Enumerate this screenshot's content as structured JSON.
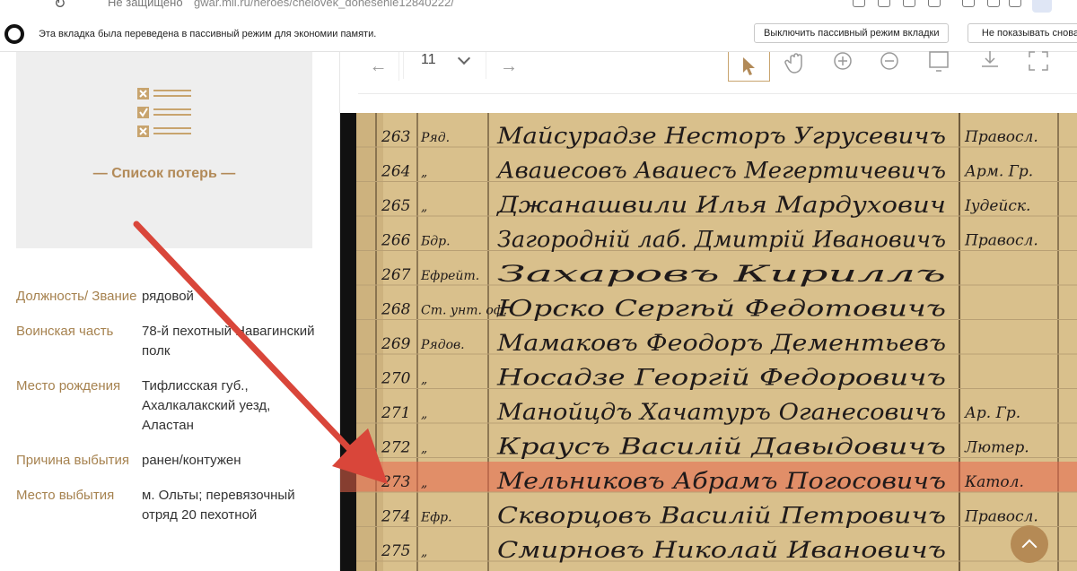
{
  "browser": {
    "security": "Не защищено",
    "url": "gwar.mil.ru/heroes/chelovek_donesenie12840222/"
  },
  "notice": {
    "message": "Эта вкладка была переведена в пассивный режим для экономии памяти.",
    "disable_button": "Выключить пассивный режим вкладки",
    "dont_show_button": "Не показывать снова"
  },
  "loss_list": {
    "title": "— Список потерь —"
  },
  "person": [
    {
      "label": "Должность/ Звание",
      "value": "рядовой"
    },
    {
      "label": "Воинская часть",
      "value": "78-й пехотный Навагинский полк"
    },
    {
      "label": "Место рождения",
      "value": "Тифлисская губ., Ахалкалакский уезд, Аластан"
    },
    {
      "label": "Причина выбытия",
      "value": "ранен/контужен"
    },
    {
      "label": "Место выбытия",
      "value": "м. Ольты; перевязочный отряд 20 пехотной"
    }
  ],
  "viewer": {
    "page": "11",
    "tools": [
      "prev-icon",
      "next-icon",
      "pointer-icon",
      "hand-icon",
      "zoom-in-icon",
      "zoom-out-icon",
      "frame-icon",
      "download-icon",
      "fullscreen-icon"
    ]
  },
  "scan": {
    "rows": [
      {
        "num": "263",
        "rank": "Ряд.",
        "name": "Майсурадзе Несторъ Угрусевичъ",
        "faith": "Правосл."
      },
      {
        "num": "264",
        "rank": "„",
        "name": "Аваиесовъ Аваиесъ Мегертичевичъ",
        "faith": "Арм. Гр."
      },
      {
        "num": "265",
        "rank": "„",
        "name": "Джанашвили Илья Мардухович",
        "faith": "Іудейск."
      },
      {
        "num": "266",
        "rank": "Бдр.",
        "name": "Загородній лаб. Дмитрій Ивановичъ",
        "faith": "Правосл."
      },
      {
        "num": "267",
        "rank": "Ефрейт.",
        "name": "Захаровъ Кириллъ",
        "faith": ""
      },
      {
        "num": "268",
        "rank": "Ст. унт. оф.",
        "name": "Юрско Сергѣй Федотовичъ",
        "faith": ""
      },
      {
        "num": "269",
        "rank": "Рядов.",
        "name": "Мамаковъ Феодоръ Дементьевъ",
        "faith": ""
      },
      {
        "num": "270",
        "rank": "„",
        "name": "Носадзе Георгій Федоровичъ",
        "faith": ""
      },
      {
        "num": "271",
        "rank": "„",
        "name": "Манойцдъ Хачатуръ Оганесовичъ",
        "faith": "Ар. Гр."
      },
      {
        "num": "272",
        "rank": "„",
        "name": "Краусъ Василій Давыдовичъ",
        "faith": "Лютер."
      },
      {
        "num": "273",
        "rank": "„",
        "name": "Мельниковъ Абрамъ Погосовичъ",
        "faith": "Катол."
      },
      {
        "num": "274",
        "rank": "Ефр.",
        "name": "Скворцовъ Василій Петровичъ",
        "faith": "Правосл."
      },
      {
        "num": "275",
        "rank": "„",
        "name": "Смирновъ Николай Ивановичъ",
        "faith": ""
      }
    ],
    "highlight_row_index": 10
  },
  "colors": {
    "accent": "#b28a58",
    "highlight": "#e8654a",
    "arrow": "#d9463a",
    "paper": "#d9c08c",
    "ink": "#1f1a1a"
  }
}
